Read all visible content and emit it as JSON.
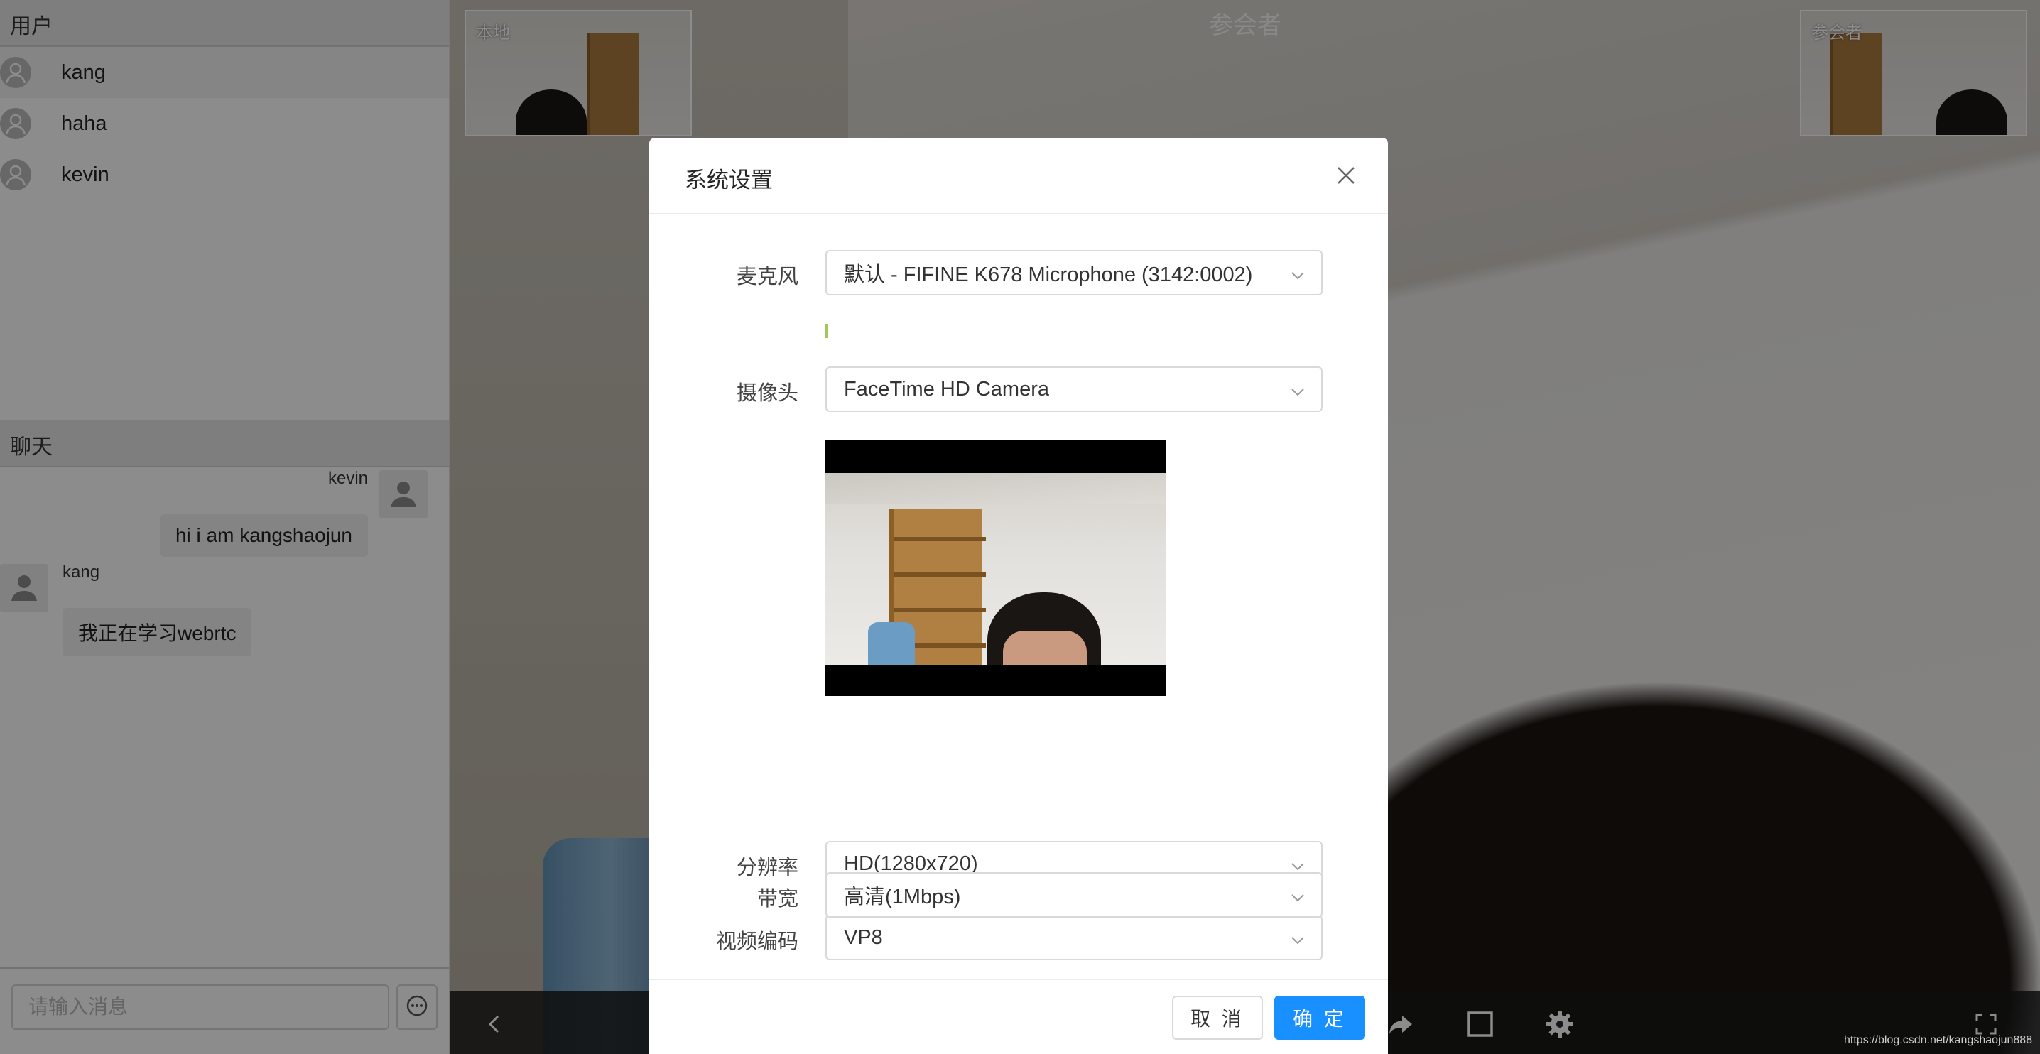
{
  "sidebar": {
    "users_header": "用户",
    "users": [
      {
        "name": "kang"
      },
      {
        "name": "haha"
      },
      {
        "name": "kevin"
      }
    ],
    "chat_header": "聊天",
    "messages": [
      {
        "sender": "kevin",
        "text": "hi i am kangshaojun",
        "side": "right"
      },
      {
        "sender": "kang",
        "text": "我正在学习webrtc",
        "side": "left"
      }
    ],
    "chat_input": {
      "placeholder": "请输入消息",
      "value": ""
    },
    "send_icon": "chat-bubble-icon"
  },
  "video": {
    "participant_label": "参会者",
    "local_label": "本地",
    "remote_label": "参会者",
    "toolbar_icons": [
      "back-chevron-icon",
      "share-arrow-icon",
      "stop-square-icon",
      "gear-icon",
      "fullscreen-icon"
    ]
  },
  "settings_modal": {
    "title": "系统设置",
    "close_icon": "close-icon",
    "microphone": {
      "label": "麦克风",
      "value": "默认 - FIFINE K678 Microphone (3142:0002)"
    },
    "camera": {
      "label": "摄像头",
      "value": "FaceTime HD Camera"
    },
    "resolution": {
      "label": "分辨率",
      "value": "HD(1280x720)"
    },
    "codec": {
      "label": "视频编码",
      "value": "VP8"
    },
    "bandwidth": {
      "label": "带宽",
      "value": "高清(1Mbps)"
    },
    "cancel_label": "取 消",
    "ok_label": "确 定",
    "accent_color": "#1890ff"
  },
  "watermark": "https://blog.csdn.net/kangshaojun888"
}
